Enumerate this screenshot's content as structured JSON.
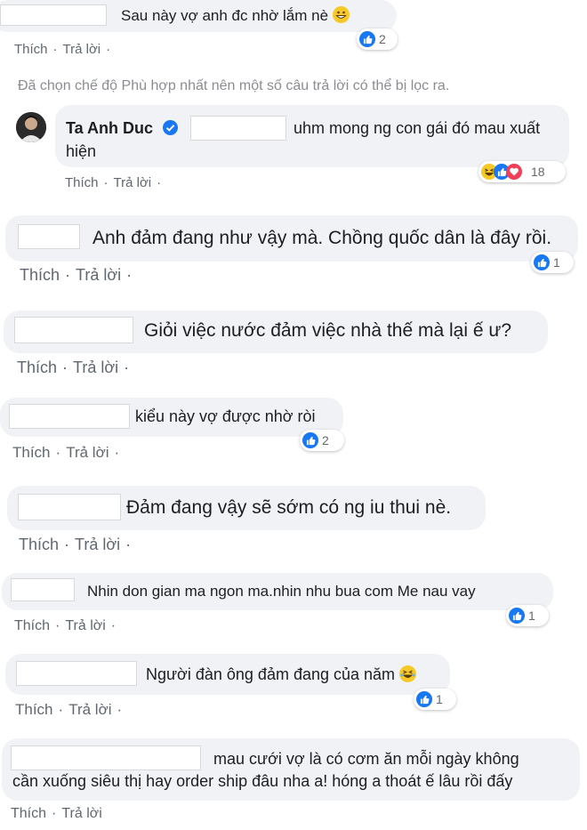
{
  "comments": [
    {
      "text": "Sau này vợ anh đc nhờ lắm nè",
      "reaction_count": "2",
      "emoji": "grin-emoji"
    },
    {
      "text": "Anh đảm đang như vậy mà. Chồng quốc dân là đây rồi.",
      "reaction_count": "1"
    },
    {
      "text": "Giỏi việc nước đảm việc nhà thế mà lại ế ư?"
    },
    {
      "text": "kiểu này vợ được nhờ ròi",
      "reaction_count": "2"
    },
    {
      "text": "Đảm đang vậy sẽ sớm có ng iu thui nè."
    },
    {
      "text": "Nhin don gian ma ngon ma.nhin nhu bua com Me nau vay",
      "reaction_count": "1"
    },
    {
      "text": "Người đàn ông đảm đang của năm",
      "reaction_count": "1",
      "emoji": "laughing-emoji"
    },
    {
      "text_line1": "mau cưới vợ là có cơm ăn mỗi ngày không",
      "text_line2": "cần xuống siêu thị hay order ship đâu nha a! hóng a thoát ế lâu rồi đấy"
    }
  ],
  "actions": {
    "like": "Thích",
    "reply": "Trả lời",
    "sep": "·"
  },
  "filter_notice": "Đã chọn chế độ Phù hợp nhất nên một số câu trả lời có thể bị lọc ra.",
  "reply": {
    "author": "Ta Anh Duc",
    "text_line1": "uhm mong ng con gái đó mau xuất",
    "text_line2": "hiện",
    "reaction_count": "18",
    "reactions": [
      "haha",
      "like",
      "love"
    ]
  },
  "colors": {
    "like_blue": "#1877f2",
    "bubble": "#f0f2f5",
    "haha_yellow": "#f7c928",
    "love_red": "#f33e58"
  }
}
